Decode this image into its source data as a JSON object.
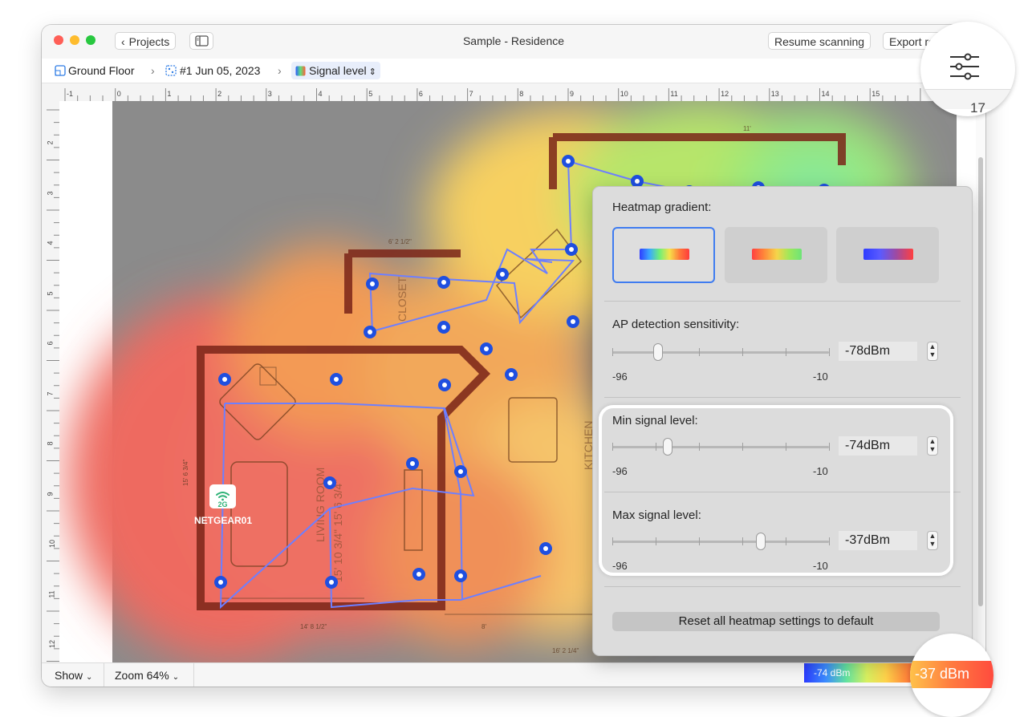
{
  "window": {
    "title": "Sample - Residence",
    "back_button": "Projects",
    "resume_button": "Resume scanning",
    "export_button": "Export re"
  },
  "breadcrumb": {
    "floor": "Ground Floor",
    "scan": "#1 Jun 05, 2023",
    "view": "Signal level"
  },
  "ruler": {
    "top_marks": [
      "-1",
      "0",
      "1",
      "2",
      "3",
      "4",
      "5",
      "6",
      "7",
      "8",
      "9",
      "10",
      "11",
      "12",
      "13",
      "14",
      "15"
    ],
    "left_marks": [
      "2",
      "3",
      "4",
      "5",
      "6",
      "7",
      "8",
      "9",
      "10",
      "11",
      "12"
    ],
    "zoom_mark": "17"
  },
  "floorplan": {
    "room_labels": [
      "LIVING ROOM",
      "15' 10 3/4\" 15' 6 3/4\"",
      "CLOSET",
      "KITCHEN"
    ],
    "dim_labels": [
      "6' 2 1/2\"",
      "14' 8 1/2\"",
      "16' 2 1/4\"",
      "11'",
      "15' 6 3/4\"",
      "8'"
    ],
    "access_point": {
      "band": "2G",
      "name": "NETGEAR01"
    }
  },
  "panel": {
    "gradient_label": "Heatmap gradient:",
    "sensitivity": {
      "label": "AP detection sensitivity:",
      "value": "-78dBm",
      "min": "-96",
      "max": "-10"
    },
    "min_signal": {
      "label": "Min signal level:",
      "value": "-74dBm",
      "min": "-96",
      "max": "-10"
    },
    "max_signal": {
      "label": "Max signal level:",
      "value": "-37dBm",
      "min": "-96",
      "max": "-10"
    },
    "reset_label": "Reset all heatmap settings to default",
    "slider_levels": {
      "sensitivity": -78,
      "min_signal": -74,
      "max_signal": -37,
      "range_min": -96,
      "range_max": -10
    }
  },
  "bottom": {
    "show_label": "Show",
    "zoom_label": "Zoom 64%",
    "legend_low": "-74 dBm",
    "legend_high": "-37 dBm"
  },
  "icons": [
    "chevron-left-icon",
    "sidebar-icon",
    "floor-icon",
    "scan-icon",
    "gradient-icon",
    "sliders-icon",
    "wifi-icon"
  ],
  "colors": {
    "accent": "#3f7cf0",
    "scan_point": "#1f4fe0",
    "heat_strong": "#ff4b3e",
    "heat_weak": "#8fe6c0"
  }
}
